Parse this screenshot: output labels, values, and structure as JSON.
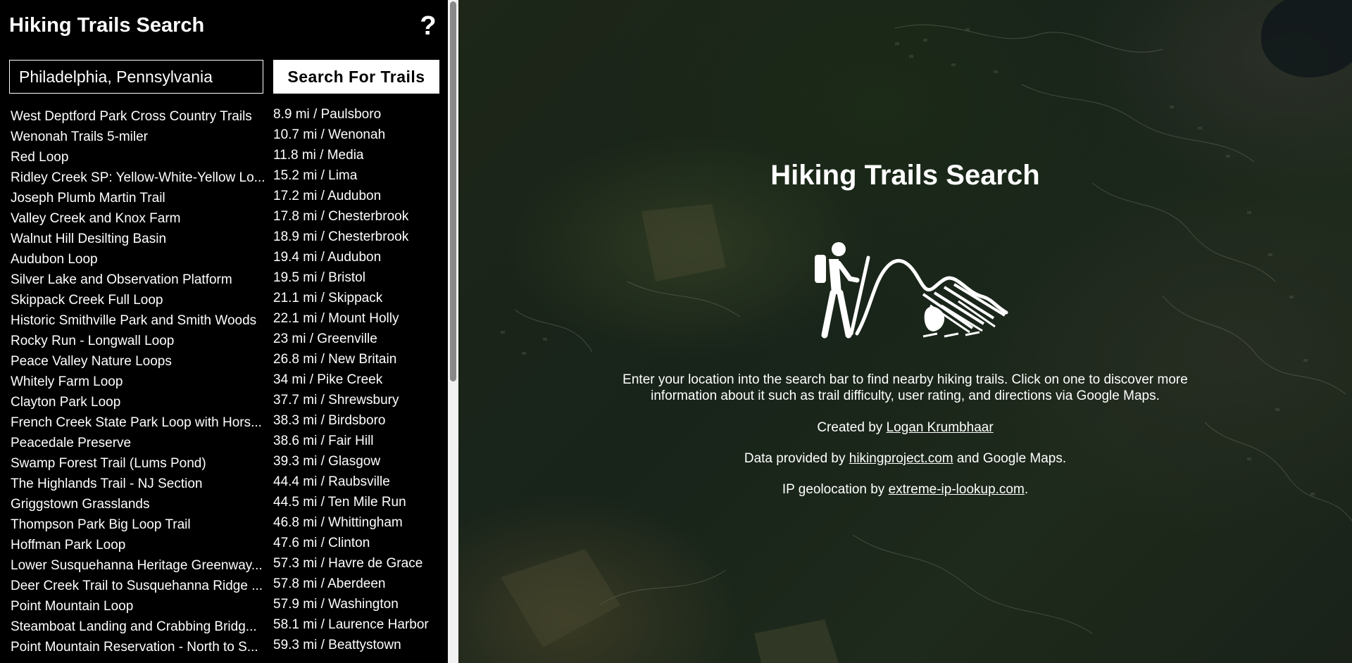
{
  "sidebar": {
    "title": "Hiking Trails Search",
    "help_icon": "question-mark-icon",
    "search": {
      "value": "Philadelphia, Pennsylvania",
      "button_label": "Search For Trails"
    },
    "trails": [
      {
        "name": "West Deptford Park Cross Country Trails",
        "distance": "8.9 mi / Paulsboro"
      },
      {
        "name": "Wenonah Trails 5-miler",
        "distance": "10.7 mi / Wenonah"
      },
      {
        "name": "Red Loop",
        "distance": "11.8 mi / Media"
      },
      {
        "name": "Ridley Creek SP: Yellow-White-Yellow Lo...",
        "distance": "15.2 mi / Lima"
      },
      {
        "name": "Joseph Plumb Martin Trail",
        "distance": "17.2 mi / Audubon"
      },
      {
        "name": "Valley Creek and Knox Farm",
        "distance": "17.8 mi / Chesterbrook"
      },
      {
        "name": "Walnut Hill Desilting Basin",
        "distance": "18.9 mi / Chesterbrook"
      },
      {
        "name": "Audubon Loop",
        "distance": "19.4 mi / Audubon"
      },
      {
        "name": "Silver Lake and Observation Platform",
        "distance": "19.5 mi / Bristol"
      },
      {
        "name": "Skippack Creek Full Loop",
        "distance": "21.1 mi / Skippack"
      },
      {
        "name": "Historic Smithville Park and Smith Woods",
        "distance": "22.1 mi / Mount Holly"
      },
      {
        "name": "Rocky Run - Longwall Loop",
        "distance": "23 mi / Greenville"
      },
      {
        "name": "Peace Valley Nature Loops",
        "distance": "26.8 mi / New Britain"
      },
      {
        "name": "Whitely Farm Loop",
        "distance": "34 mi / Pike Creek"
      },
      {
        "name": "Clayton Park Loop",
        "distance": "37.7 mi / Shrewsbury"
      },
      {
        "name": "French Creek State Park Loop with Hors...",
        "distance": "38.3 mi / Birdsboro"
      },
      {
        "name": "Peacedale Preserve",
        "distance": "38.6 mi / Fair Hill"
      },
      {
        "name": "Swamp Forest Trail (Lums Pond)",
        "distance": "39.3 mi / Glasgow"
      },
      {
        "name": "The Highlands Trail - NJ Section",
        "distance": "44.4 mi / Raubsville"
      },
      {
        "name": "Griggstown Grasslands",
        "distance": "44.5 mi / Ten Mile Run"
      },
      {
        "name": "Thompson Park Big Loop Trail",
        "distance": "46.8 mi / Whittingham"
      },
      {
        "name": "Hoffman Park Loop",
        "distance": "47.6 mi / Clinton"
      },
      {
        "name": "Lower Susquehanna Heritage Greenway...",
        "distance": "57.3 mi / Havre de Grace"
      },
      {
        "name": "Deer Creek Trail to Susquehanna Ridge ...",
        "distance": "57.8 mi / Aberdeen"
      },
      {
        "name": "Point Mountain Loop",
        "distance": "57.9 mi / Washington"
      },
      {
        "name": "Steamboat Landing and Crabbing Bridg...",
        "distance": "58.1 mi / Laurence Harbor"
      },
      {
        "name": "Point Mountain Reservation - North to S...",
        "distance": "59.3 mi / Beattystown"
      }
    ]
  },
  "main": {
    "title": "Hiking Trails Search",
    "hero_icon": "hiker-mountain-icon",
    "description": "Enter your location into the search bar to find nearby hiking trails. Click on one to discover more information about it such as trail difficulty, user rating, and directions via Google Maps.",
    "created_by_prefix": "Created by ",
    "created_by_link": "Logan Krumbhaar",
    "data_prefix": "Data provided by ",
    "data_link": "hikingproject.com",
    "data_suffix": " and Google Maps.",
    "geo_prefix": "IP geolocation by ",
    "geo_link": "extreme-ip-lookup.com",
    "geo_suffix": "."
  }
}
